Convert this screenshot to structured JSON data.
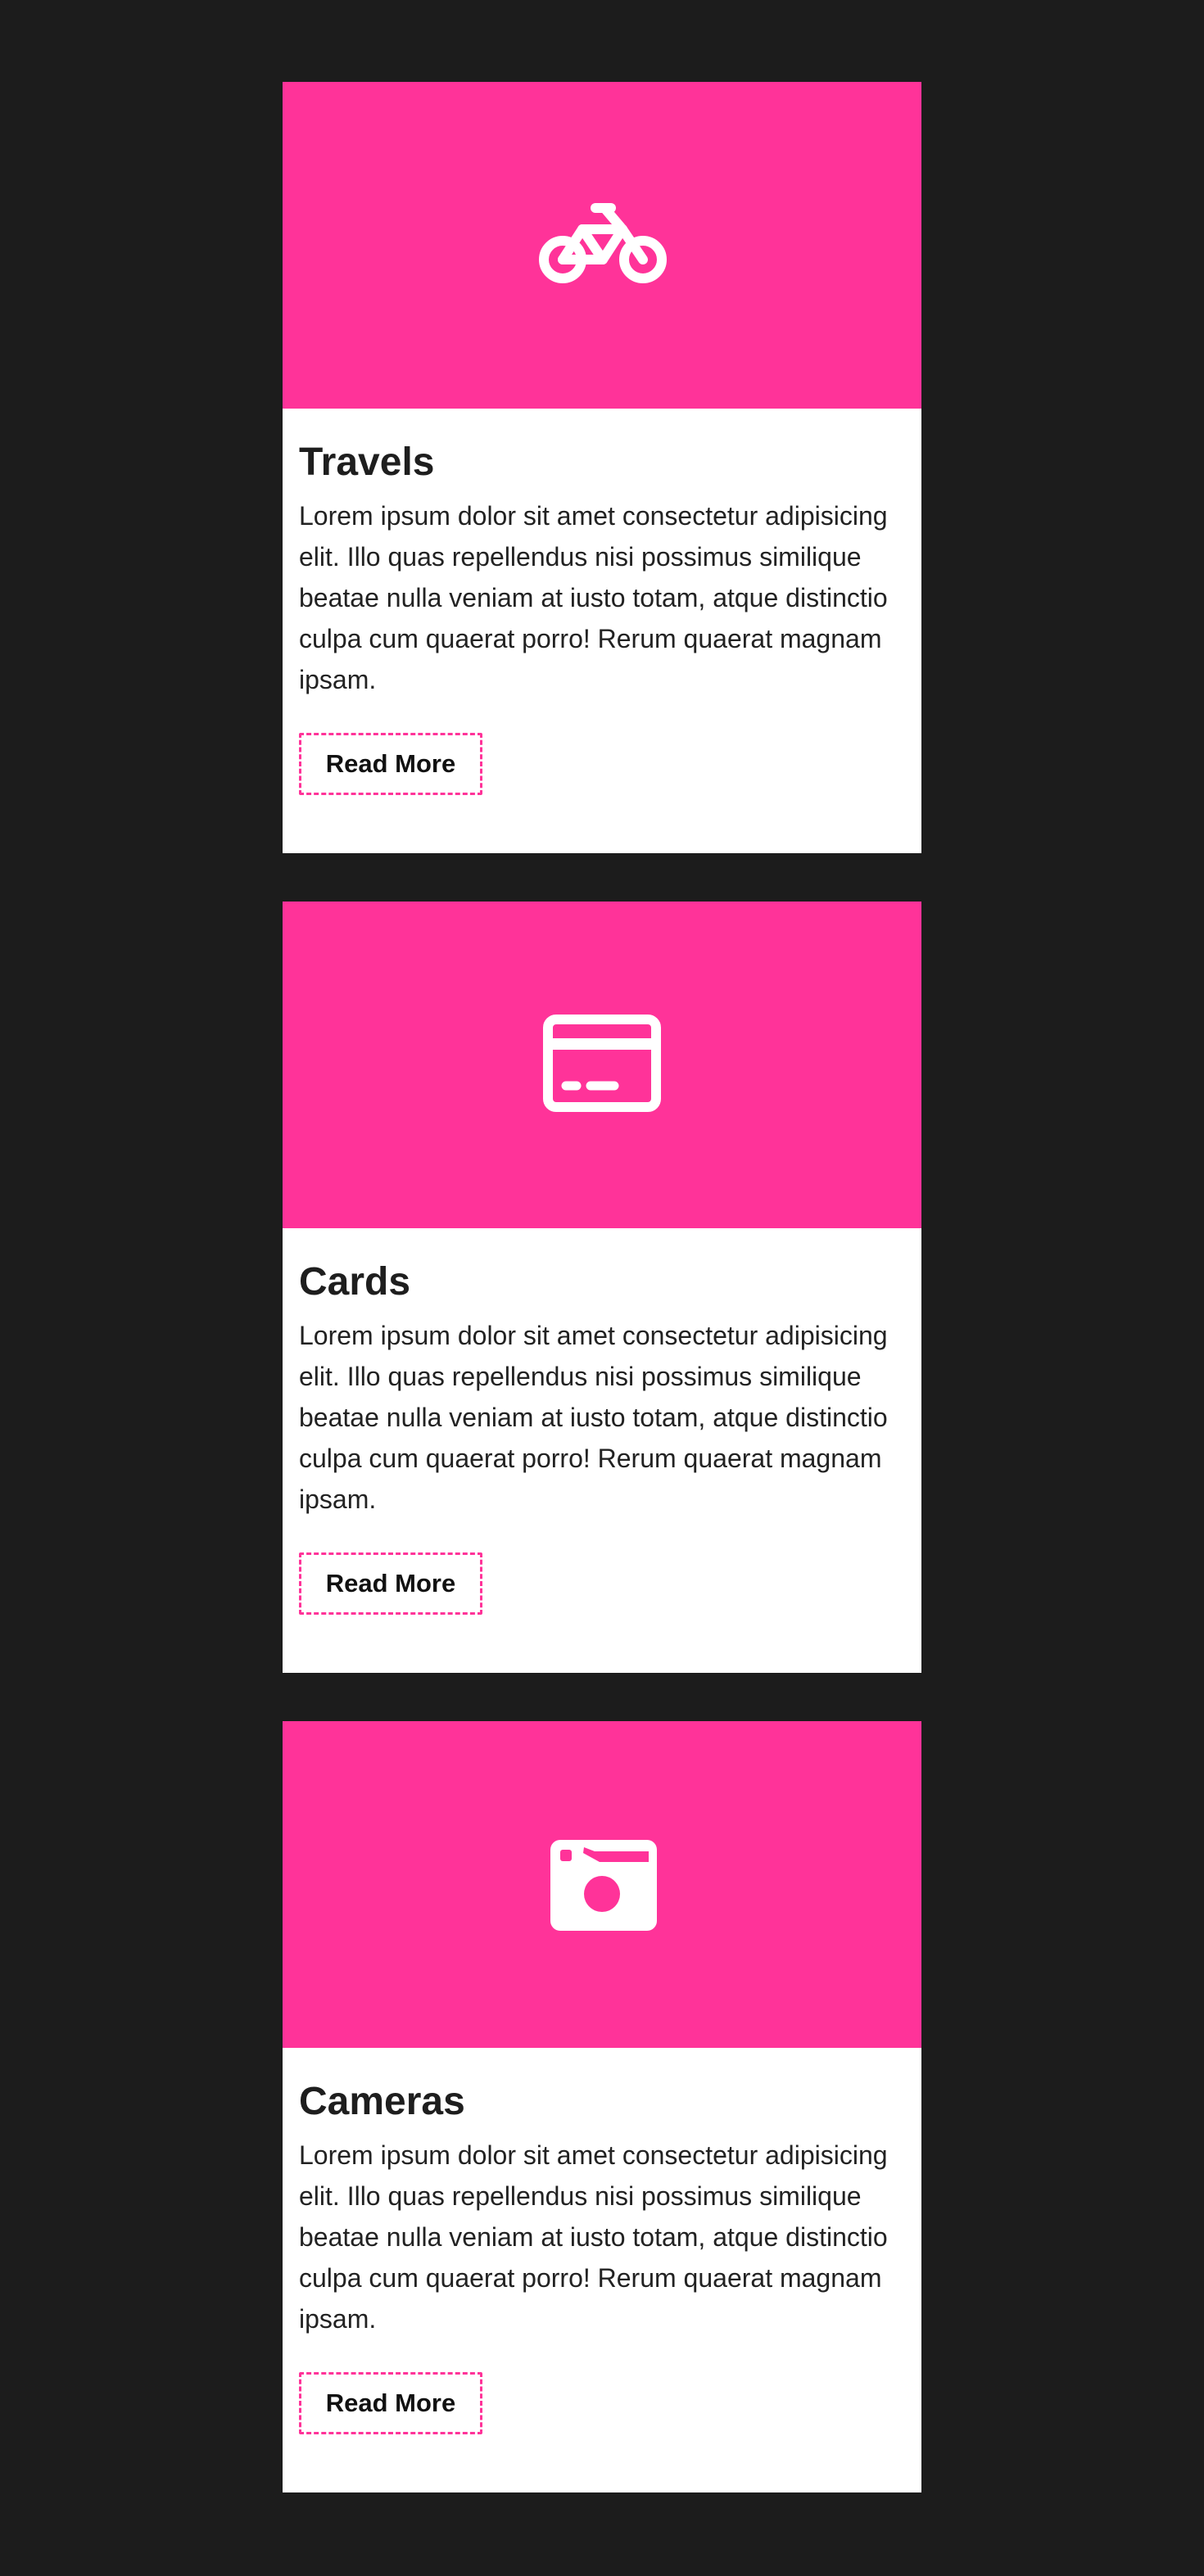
{
  "colors": {
    "background": "#1c1c1c",
    "accent": "#ff3399",
    "card_bg": "#ffffff",
    "title_text": "#1e1e1e",
    "body_text": "#222222"
  },
  "cards": [
    {
      "icon": "bicycle-icon",
      "title": "Travels",
      "text": "Lorem ipsum dolor sit amet consectetur adipisicing elit. Illo quas repellendus nisi possimus similique beatae nulla veniam at iusto totam, atque distinctio culpa cum quaerat porro! Rerum quaerat magnam ipsam.",
      "button_label": "Read More"
    },
    {
      "icon": "credit-card-icon",
      "title": "Cards",
      "text": "Lorem ipsum dolor sit amet consectetur adipisicing elit. Illo quas repellendus nisi possimus similique beatae nulla veniam at iusto totam, atque distinctio culpa cum quaerat porro! Rerum quaerat magnam ipsam.",
      "button_label": "Read More"
    },
    {
      "icon": "camera-icon",
      "title": "Cameras",
      "text": "Lorem ipsum dolor sit amet consectetur adipisicing elit. Illo quas repellendus nisi possimus similique beatae nulla veniam at iusto totam, atque distinctio culpa cum quaerat porro! Rerum quaerat magnam ipsam.",
      "button_label": "Read More"
    }
  ]
}
